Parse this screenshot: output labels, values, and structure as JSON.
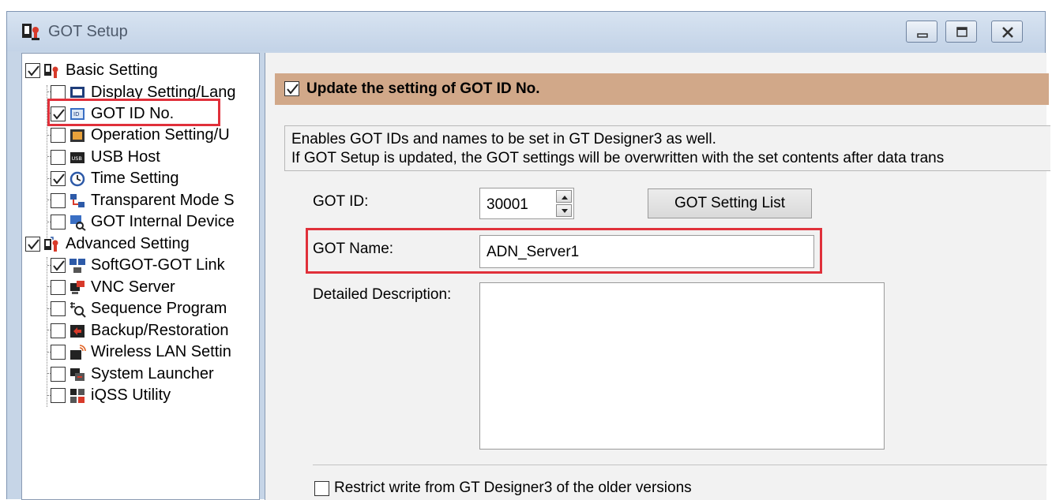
{
  "window": {
    "title": "GOT Setup",
    "controls": [
      "minimize",
      "maximize",
      "close"
    ]
  },
  "tree": {
    "groups": [
      {
        "label": "Basic Setting",
        "checked": true,
        "items": [
          {
            "label": "Display Setting/Lang",
            "checked": false,
            "icon": "display-icon"
          },
          {
            "label": "GOT ID No.",
            "checked": true,
            "icon": "id-card-icon",
            "selected": true
          },
          {
            "label": "Operation Setting/U",
            "checked": false,
            "icon": "operation-icon"
          },
          {
            "label": "USB Host",
            "checked": false,
            "icon": "usb-icon"
          },
          {
            "label": "Time Setting",
            "checked": true,
            "icon": "clock-icon"
          },
          {
            "label": "Transparent Mode S",
            "checked": false,
            "icon": "network-icon"
          },
          {
            "label": "GOT Internal Device",
            "checked": false,
            "icon": "device-search-icon"
          }
        ]
      },
      {
        "label": "Advanced Setting",
        "checked": true,
        "items": [
          {
            "label": "SoftGOT-GOT Link",
            "checked": true,
            "icon": "link-icon"
          },
          {
            "label": "VNC Server",
            "checked": false,
            "icon": "vnc-icon"
          },
          {
            "label": "Sequence Program",
            "checked": false,
            "icon": "sequence-icon"
          },
          {
            "label": "Backup/Restoration",
            "checked": false,
            "icon": "backup-icon"
          },
          {
            "label": "Wireless LAN Settin",
            "checked": false,
            "icon": "wireless-icon"
          },
          {
            "label": "System Launcher",
            "checked": false,
            "icon": "launcher-icon"
          },
          {
            "label": "iQSS Utility",
            "checked": false,
            "icon": "utility-icon"
          }
        ]
      }
    ]
  },
  "main": {
    "header": {
      "checkbox_checked": true,
      "label": "Update the setting of GOT ID No."
    },
    "description": {
      "line1": "Enables GOT IDs and names to be set in GT Designer3 as well.",
      "line2": "If GOT Setup is updated, the GOT settings will be overwritten with the set contents after data trans"
    },
    "got_id": {
      "label": "GOT ID:",
      "value": "30001"
    },
    "setting_list_button": "GOT Setting List",
    "got_name": {
      "label": "GOT Name:",
      "value": "ADN_Server1"
    },
    "detailed_description": {
      "label": "Detailed Description:",
      "value": ""
    },
    "restrict_write": {
      "label": "Restrict write from GT Designer3 of the older versions",
      "checked": false
    }
  },
  "colors": {
    "header_bar": "#d1a889",
    "highlight_box": "#e0303a",
    "window_frame": "#c6d5e7"
  }
}
